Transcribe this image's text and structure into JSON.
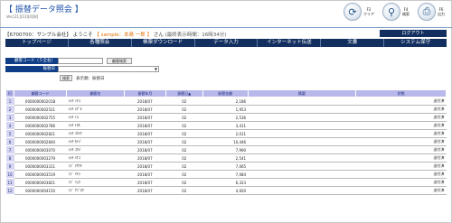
{
  "header": {
    "title": "【 振替データ照会 】",
    "version": "Ver.[21][13][4][8]"
  },
  "fkeys": [
    {
      "key": "F2",
      "label": "クリア",
      "icon": "refresh-icon"
    },
    {
      "key": "F4",
      "label": "検索",
      "icon": "search-icon"
    },
    {
      "key": "F6",
      "label": "出力",
      "icon": "output-icon"
    }
  ],
  "welcome": {
    "company": "【6700700：サンプル会社】",
    "greeting": "ようこそ",
    "user": "【 sample：本島 一郎 】",
    "suffix": "さん",
    "last_login": "(最終表示時間：16時34分)"
  },
  "logout_label": "ログアウト",
  "nav": [
    "トップページ",
    "各種照会",
    "帳票ダウンロード",
    "データ入力",
    "インターネット伝送",
    "文書",
    "システム保守"
  ],
  "form": {
    "customer_code_label": "顧客コード（５全右）",
    "customer_code_value": "",
    "customer_search_button": "顧客検索",
    "transfer_date_label": "振替日",
    "transfer_date_value": "",
    "display_button": "検索",
    "display_order": "表示順：振替日"
  },
  "table": {
    "headers": [
      "行",
      "顧客コード",
      "顧客名",
      "振替年月",
      "振替日▲",
      "振替金額",
      "摘要",
      "状態"
    ],
    "rows": [
      {
        "no": "1",
        "code": "000000000201B",
        "name": "ｼﾗｷ ﾐﾁｺ",
        "month": "2018/07",
        "day": "02",
        "amount": "2,186",
        "note": "",
        "status": "送付済"
      },
      {
        "no": "2",
        "code": "0000000002521",
        "name": "ｼﾗｷ ｼｹﾞﾙ",
        "month": "2018/07",
        "day": "02",
        "amount": "1,953",
        "note": "",
        "status": "送付済"
      },
      {
        "no": "3",
        "code": "0000000002755",
        "name": "ｼﾗｷ ﾐﾕ",
        "month": "2018/07",
        "day": "02",
        "amount": "2,536",
        "note": "",
        "status": "送付済"
      },
      {
        "no": "4",
        "code": "0000000002786",
        "name": "ｼﾗｷ ﾄｵﾙ",
        "month": "2018/07",
        "day": "02",
        "amount": "3,411",
        "note": "",
        "status": "送付済"
      },
      {
        "no": "5",
        "code": "0000000002821",
        "name": "ｼﾗｷ ｺｳｲﾁ",
        "month": "2018/07",
        "day": "02",
        "amount": "2,011",
        "note": "",
        "status": "送付済"
      },
      {
        "no": "6",
        "code": "0000000002840",
        "name": "ｼﾗｷ ｾｲｼﾞ",
        "month": "2018/07",
        "day": "02",
        "amount": "10,446",
        "note": "",
        "status": "送付済"
      },
      {
        "no": "7",
        "code": "0000000003070",
        "name": "ｼﾗｷ ｺｳｼﾞ",
        "month": "2018/07",
        "day": "02",
        "amount": "7,990",
        "note": "",
        "status": "送付済"
      },
      {
        "no": "8",
        "code": "0000000003279",
        "name": "ｼﾗｷ ﾊﾅｺ",
        "month": "2018/07",
        "day": "02",
        "amount": "2,541",
        "note": "",
        "status": "送付済"
      },
      {
        "no": "9",
        "code": "0000000003311",
        "name": "ﾌｼﾞ ﾏｻｱｷ",
        "month": "2018/07",
        "day": "02",
        "amount": "7,065",
        "note": "",
        "status": "送付済"
      },
      {
        "no": "10",
        "code": "0000000003519",
        "name": "ﾌｼﾞ ｱｷﾗ",
        "month": "2018/07",
        "day": "02",
        "amount": "7,084",
        "note": "",
        "status": "送付済"
      },
      {
        "no": "11",
        "code": "0000000003821",
        "name": "ﾌｼﾞ ﾘｮｳ",
        "month": "2018/07",
        "day": "02",
        "amount": "6,323",
        "note": "",
        "status": "送付済"
      },
      {
        "no": "12",
        "code": "0000000004150",
        "name": "ﾌｼﾞ ｻﾌﾞﾛｳ",
        "month": "2018/07",
        "day": "02",
        "amount": "4,920",
        "note": "",
        "status": "送付済"
      }
    ]
  }
}
